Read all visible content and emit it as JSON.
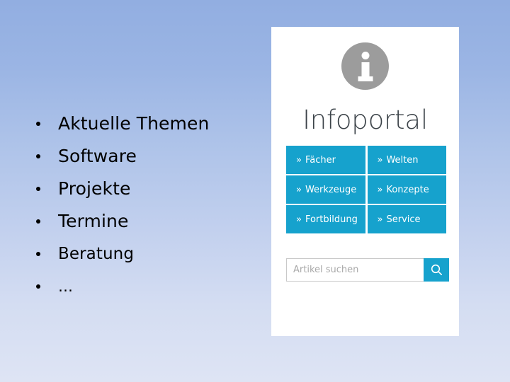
{
  "slide": {
    "background_top_color": "#92AEE1",
    "background_bottom_color": "#DEE4F4"
  },
  "bullets": {
    "items": [
      {
        "label": "Aktuelle Themen",
        "size": "big"
      },
      {
        "label": "Software",
        "size": "big"
      },
      {
        "label": "Projekte",
        "size": "big"
      },
      {
        "label": "Termine",
        "size": "big"
      },
      {
        "label": "Beratung",
        "size": "medium"
      },
      {
        "label": "…",
        "size": "small"
      }
    ]
  },
  "portal": {
    "icon_name": "info-circle-icon",
    "icon_color": "#9C9C9C",
    "title": "Infoportal",
    "title_color": "#3C4349",
    "card_background": "#FFFFFF",
    "tile_color": "#16A2CD",
    "tiles": [
      {
        "chevron": "»",
        "label": "Fächer"
      },
      {
        "chevron": "»",
        "label": "Welten"
      },
      {
        "chevron": "»",
        "label": "Werkzeuge"
      },
      {
        "chevron": "»",
        "label": "Konzepte"
      },
      {
        "chevron": "»",
        "label": "Fortbildung"
      },
      {
        "chevron": "»",
        "label": "Service"
      }
    ],
    "search": {
      "placeholder": "Artikel suchen",
      "value": "",
      "button_icon": "search-icon",
      "button_color": "#16A2CD"
    }
  }
}
